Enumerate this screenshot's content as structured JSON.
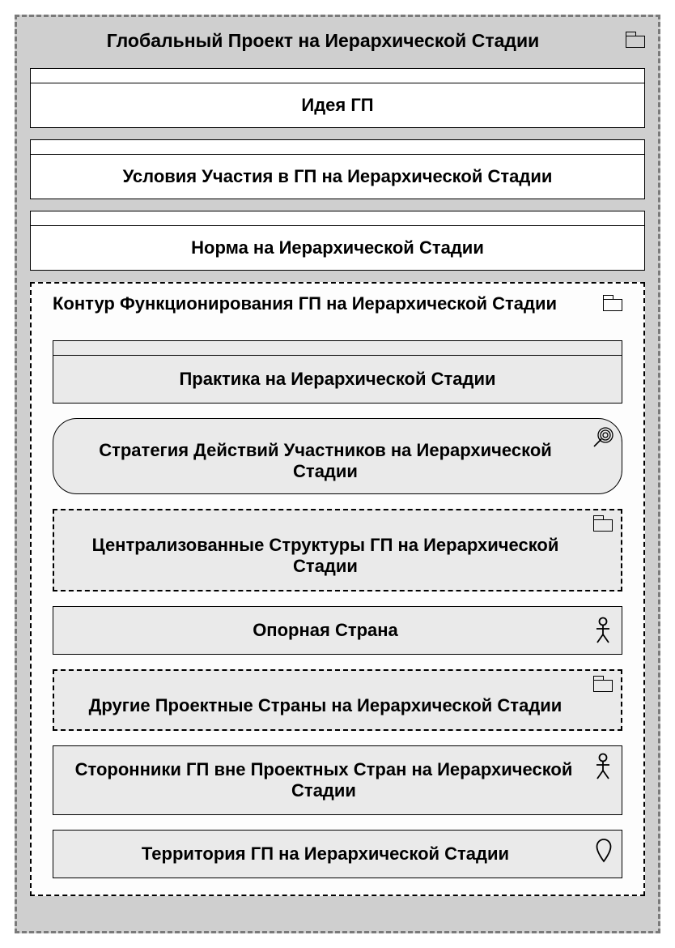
{
  "outer": {
    "title": "Глобальный Проект на Иерархической Стадии",
    "blocks": {
      "idea": "Идея ГП",
      "conditions": "Условия Участия в ГП на Иерархической Стадии",
      "norm": "Норма  на Иерархической Стадии"
    }
  },
  "inner": {
    "title": "Контур Функционирования ГП на Иерархической Стадии",
    "items": {
      "practice": "Практика на Иерархической Стадии",
      "strategy": "Стратегия Действий Участников на Иерархической Стадии",
      "centralized": "Централизованные Структуры ГП на Иерархической Стадии",
      "anchor_country": "Опорная Страна",
      "other_countries": "Другие Проектные Страны на Иерархической Стадии",
      "supporters": "Сторонники ГП вне Проектных Стран на Иерархической Стадии",
      "territory": "Территория ГП на Иерархической Стадии"
    }
  }
}
